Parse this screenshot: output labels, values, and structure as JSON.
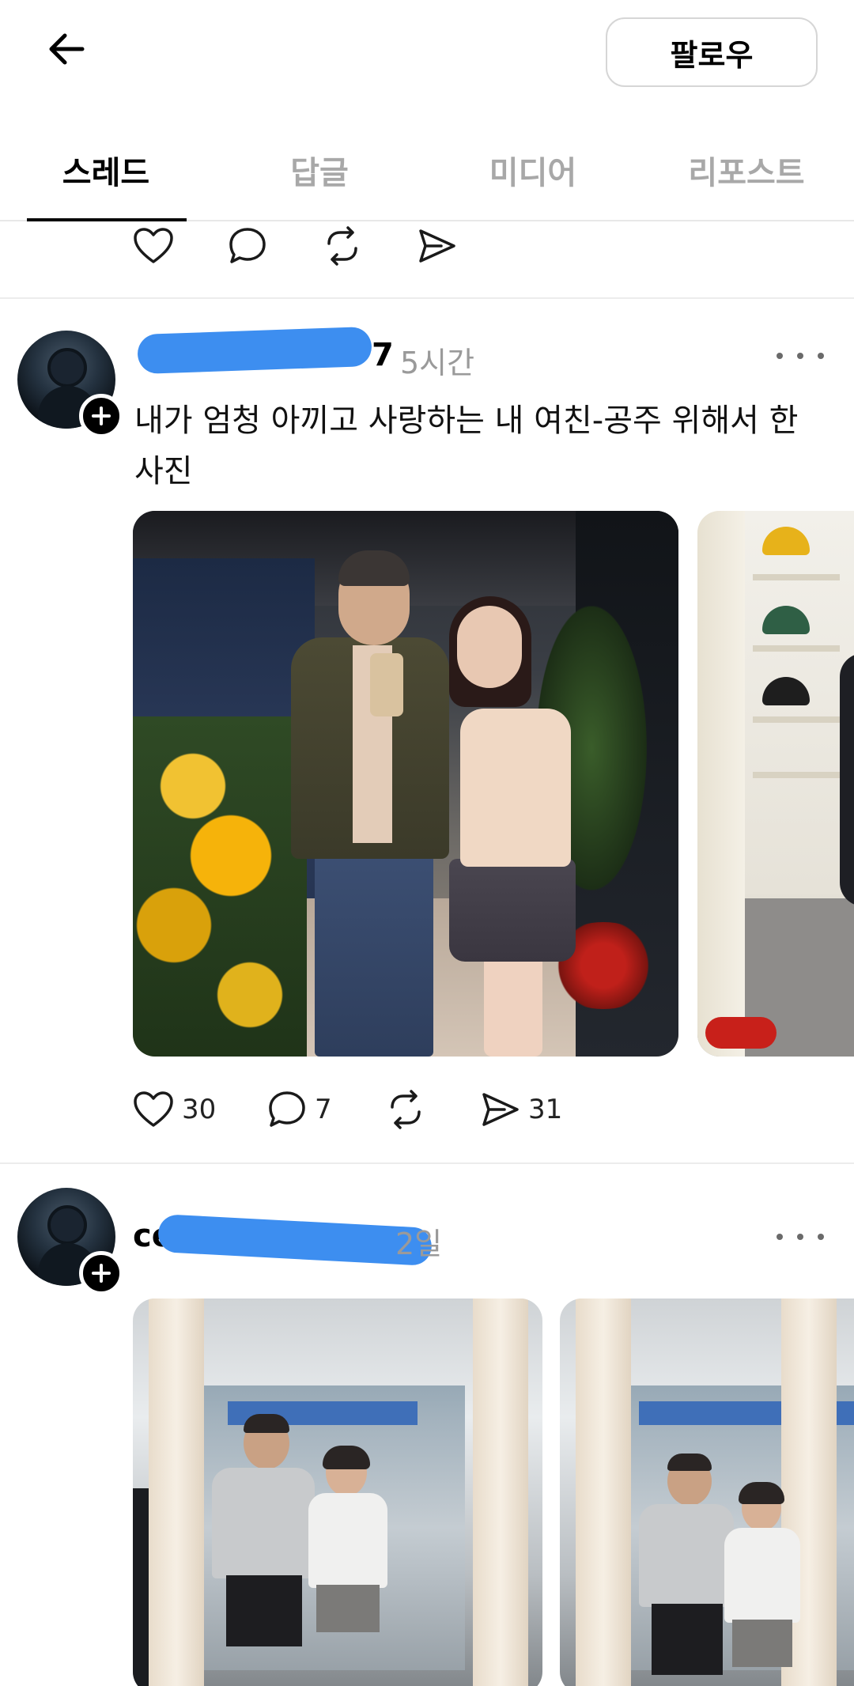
{
  "header": {
    "follow_label": "팔로우"
  },
  "tabs": [
    {
      "label": "스레드",
      "active": true
    },
    {
      "label": "답글",
      "active": false
    },
    {
      "label": "미디어",
      "active": false
    },
    {
      "label": "리포스트",
      "active": false
    }
  ],
  "posts": [
    {
      "username_visible": "7",
      "time": "5시간",
      "text": "내가 엄청 아끼고 사랑하는 내 여친-공주 위해서 한 사진",
      "likes": "30",
      "comments": "7",
      "shares": "31"
    },
    {
      "username_visible": "ce",
      "time": "2일"
    }
  ],
  "icons": {
    "back": "arrow-left-icon",
    "like": "heart-icon",
    "comment": "comment-bubble-icon",
    "repost": "repost-icon",
    "share": "send-icon",
    "more": "more-horizontal-icon",
    "follow_badge": "plus-icon"
  },
  "colors": {
    "redaction": "#3d8ef0",
    "muted_text": "#9a9a9a",
    "active_tab": "#000000",
    "inactive_tab": "#a8a8a8"
  }
}
